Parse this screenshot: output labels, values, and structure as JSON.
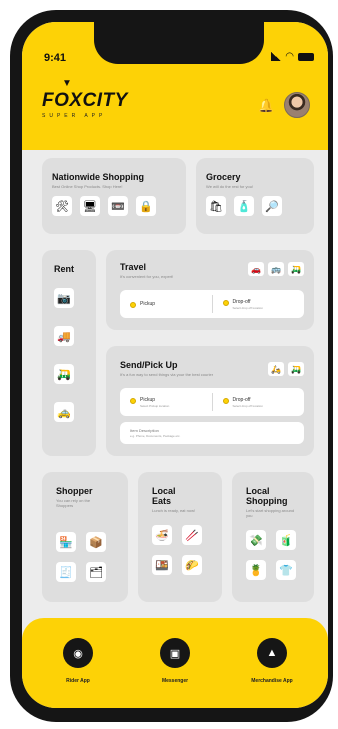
{
  "status": {
    "time": "9:41"
  },
  "brand": {
    "name": "FOXCITY",
    "tagline": "SUPER APP"
  },
  "cards": {
    "nationwide": {
      "title": "Nationwide Shopping",
      "subtitle": "Best Online Shop Products. Shop Here!",
      "icons": [
        "🛠",
        "🖥",
        "📼",
        "🔒"
      ]
    },
    "grocery": {
      "title": "Grocery",
      "subtitle": "We will do the rest for you!",
      "icons": [
        "🛍",
        "🧴",
        "🔎"
      ]
    },
    "rent": {
      "title": "Rent",
      "icons": [
        "📷",
        "🚚",
        "🛺",
        "🚕"
      ]
    },
    "travel": {
      "title": "Travel",
      "subtitle": "It's convenient for you, expert!",
      "mini_icons": [
        "🚗",
        "🚌",
        "🛺"
      ],
      "pickup_label": "Pickup",
      "dropoff_label": "Drop-off",
      "dropoff_sub": "Select drop off location"
    },
    "send": {
      "title": "Send/Pick Up",
      "subtitle": "It's a fun way to send things via your the best courier",
      "mini_icons": [
        "🛵",
        "🛺"
      ],
      "pickup_label": "Pickup",
      "pickup_sub": "Select Pickup location",
      "dropoff_label": "Drop-off",
      "dropoff_sub": "Select drop off location",
      "item_label": "Item Description",
      "item_sub": "e.g. Phone, Documents, Package etc."
    },
    "shopper": {
      "title": "Shopper",
      "subtitle": "You can rely on the Shoppers",
      "icons": [
        "🏪",
        "📦",
        "🧾",
        "🗂"
      ]
    },
    "local_eats": {
      "title_line1": "Local",
      "title_line2": "Eats",
      "subtitle": "Lunch is ready, eat now!",
      "icons": [
        "🍜",
        "🥢",
        "🍱",
        "🌮"
      ]
    },
    "local_shopping": {
      "title_line1": "Local",
      "title_line2": "Shopping",
      "subtitle": "Let's start shopping around you",
      "icons": [
        "💸",
        "🧃",
        "🍍",
        "👕"
      ]
    }
  },
  "bottom_nav": [
    {
      "label": "Rider App",
      "icon": "rider-icon"
    },
    {
      "label": "Messenger",
      "icon": "chat-icon"
    },
    {
      "label": "Merchandise App",
      "icon": "bag-icon"
    }
  ],
  "colors": {
    "accent": "#fdd206",
    "background": "#ececec",
    "card": "#dedede",
    "dark": "#161616"
  }
}
